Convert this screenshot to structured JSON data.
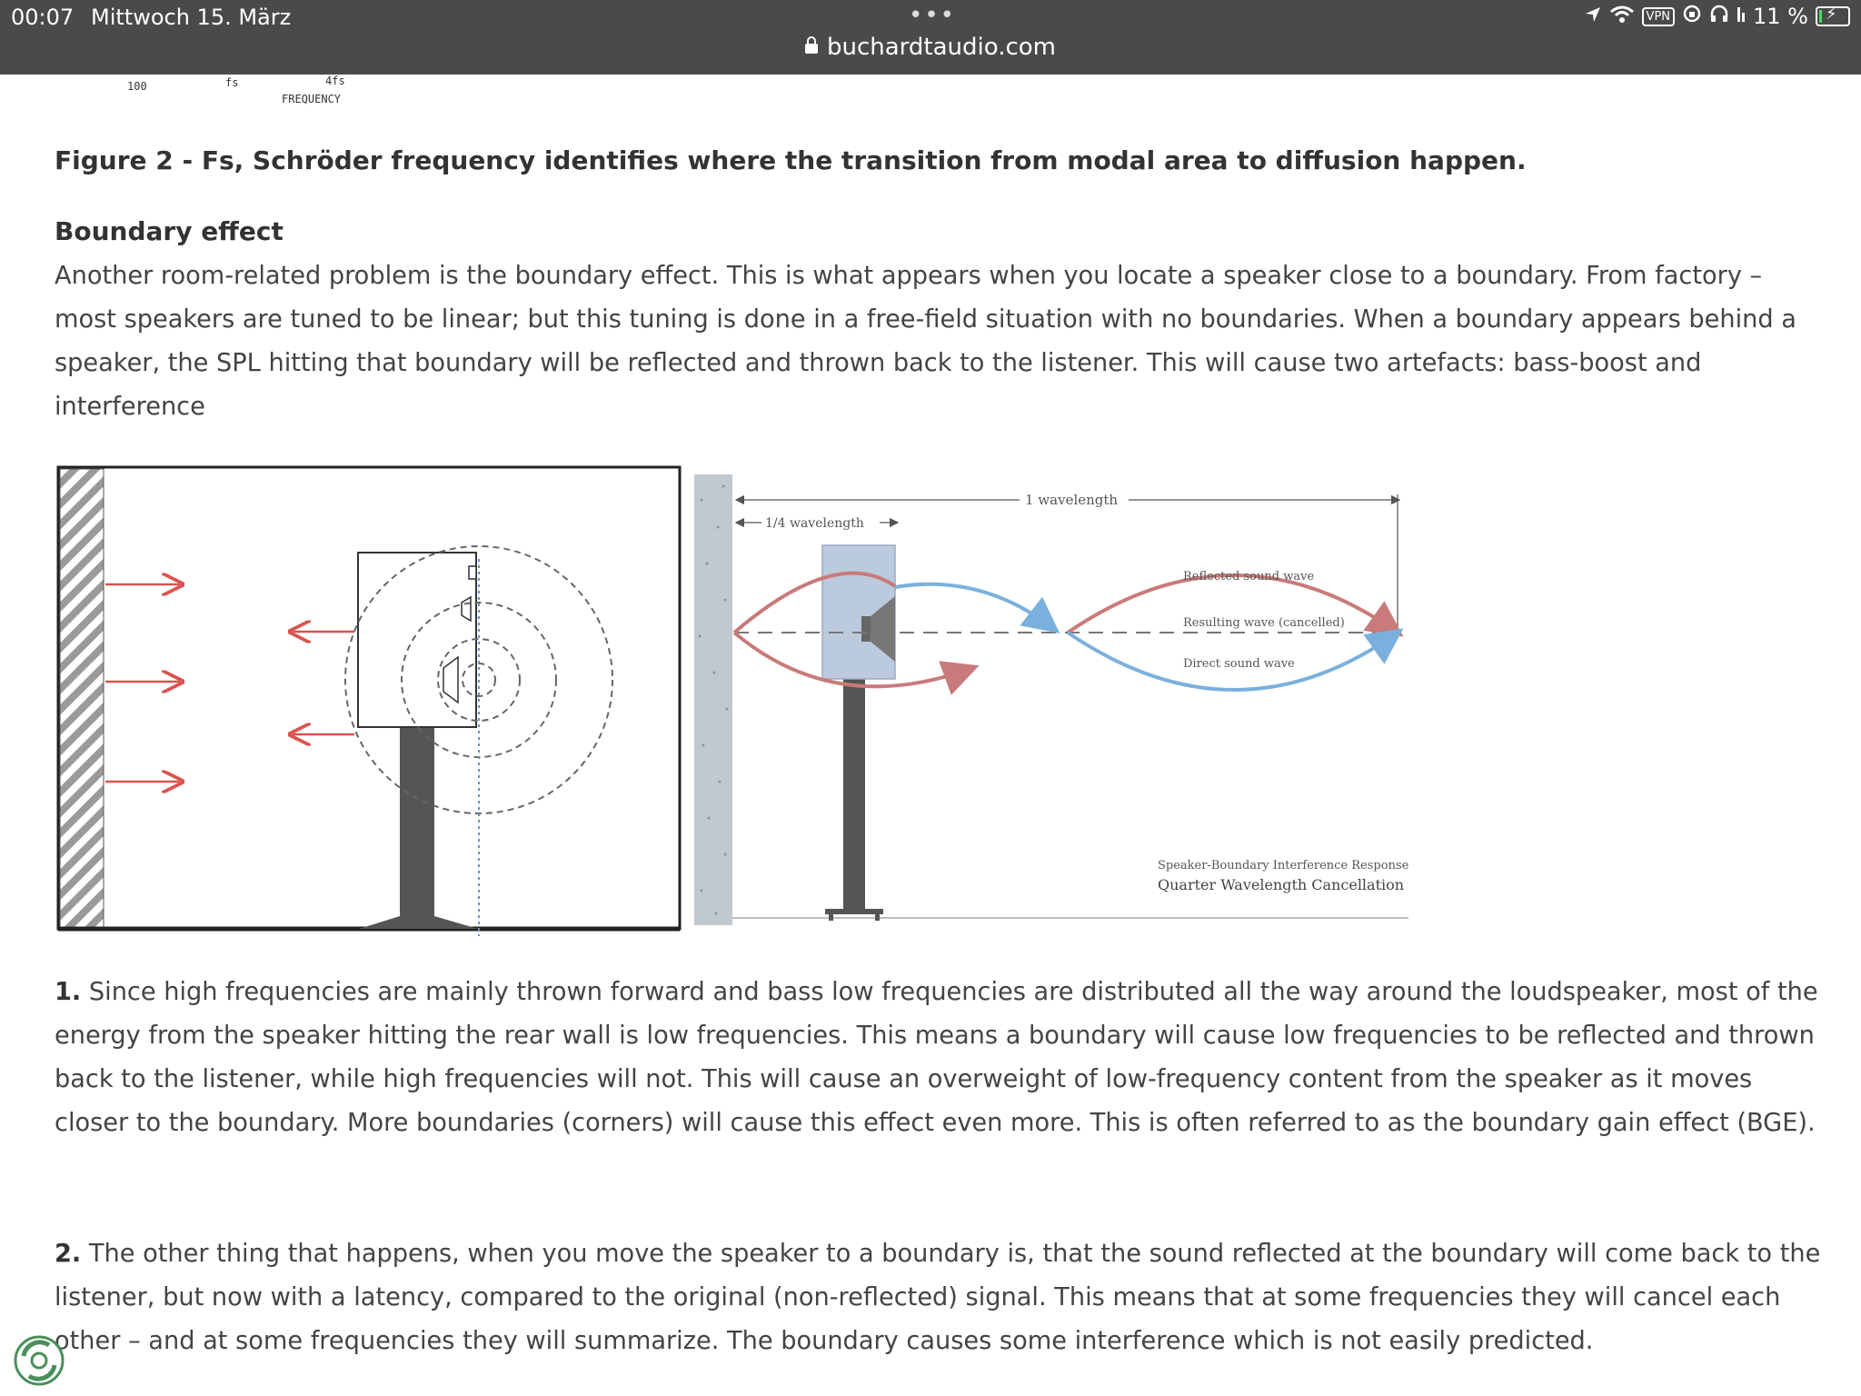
{
  "status_bar": {
    "time": "00:07",
    "date": "Mittwoch 15. März",
    "dots": "•••",
    "vpn": "VPN",
    "battery": "11 %",
    "battery_level": 0.11
  },
  "browser": {
    "url": "buchardtaudio.com"
  },
  "previous_figure": {
    "ticks": [
      "100",
      "fs",
      "4fs"
    ],
    "axis_label": "FREQUENCY"
  },
  "figure2_caption": "Figure 2 - Fs, Schröder frequency identifies where the transition from modal area to diffusion happen.",
  "section": {
    "heading": "Boundary effect",
    "intro": "Another room-related problem is the boundary effect. This is what appears when you locate a speaker close to a boundary. From factory – most speakers are tuned to be linear; but this tuning is done in a free-field situation with no boundaries. When a boundary appears behind a speaker, the SPL hitting that boundary will be reflected and thrown back to the listener. This will cause two artefacts: bass-boost and interference"
  },
  "diagram": {
    "one_wavelength": "1 wavelength",
    "quarter_wavelength": "1/4  wavelength",
    "reflected": "Reflected sound wave",
    "resulting": "Resulting wave (cancelled)",
    "direct": "Direct sound wave",
    "caption_small": "Speaker-Boundary Interference Response",
    "caption_main": "Quarter Wavelength Cancellation"
  },
  "points": [
    {
      "number": "1.",
      "text": " Since high frequencies are mainly thrown forward and bass low frequencies are distributed all the way around the loudspeaker, most of the energy from the speaker hitting the rear wall is low frequencies. This means a boundary will cause low frequencies to be reflected and thrown back to the listener, while high frequencies will not. This will cause an overweight of low-frequency content from the speaker as it moves closer to the boundary. More boundaries (corners) will cause this effect even more. This is often referred to as the boundary gain effect (BGE)."
    },
    {
      "number": "2.",
      "text": " The other thing that happens, when you move the speaker to a boundary is, that the sound reflected at the boundary will come back to the listener, but now with a latency, compared to the original (non-reflected) signal. This means that at some frequencies they will cancel each other – and at some frequencies they will summarize. The boundary causes some interference which is not easily predicted."
    }
  ],
  "colors": {
    "topbar": "#4a4a4a",
    "red_wave": "#c97a7a",
    "blue_wave": "#7ab0dd",
    "arrow_red": "#d9534f"
  }
}
